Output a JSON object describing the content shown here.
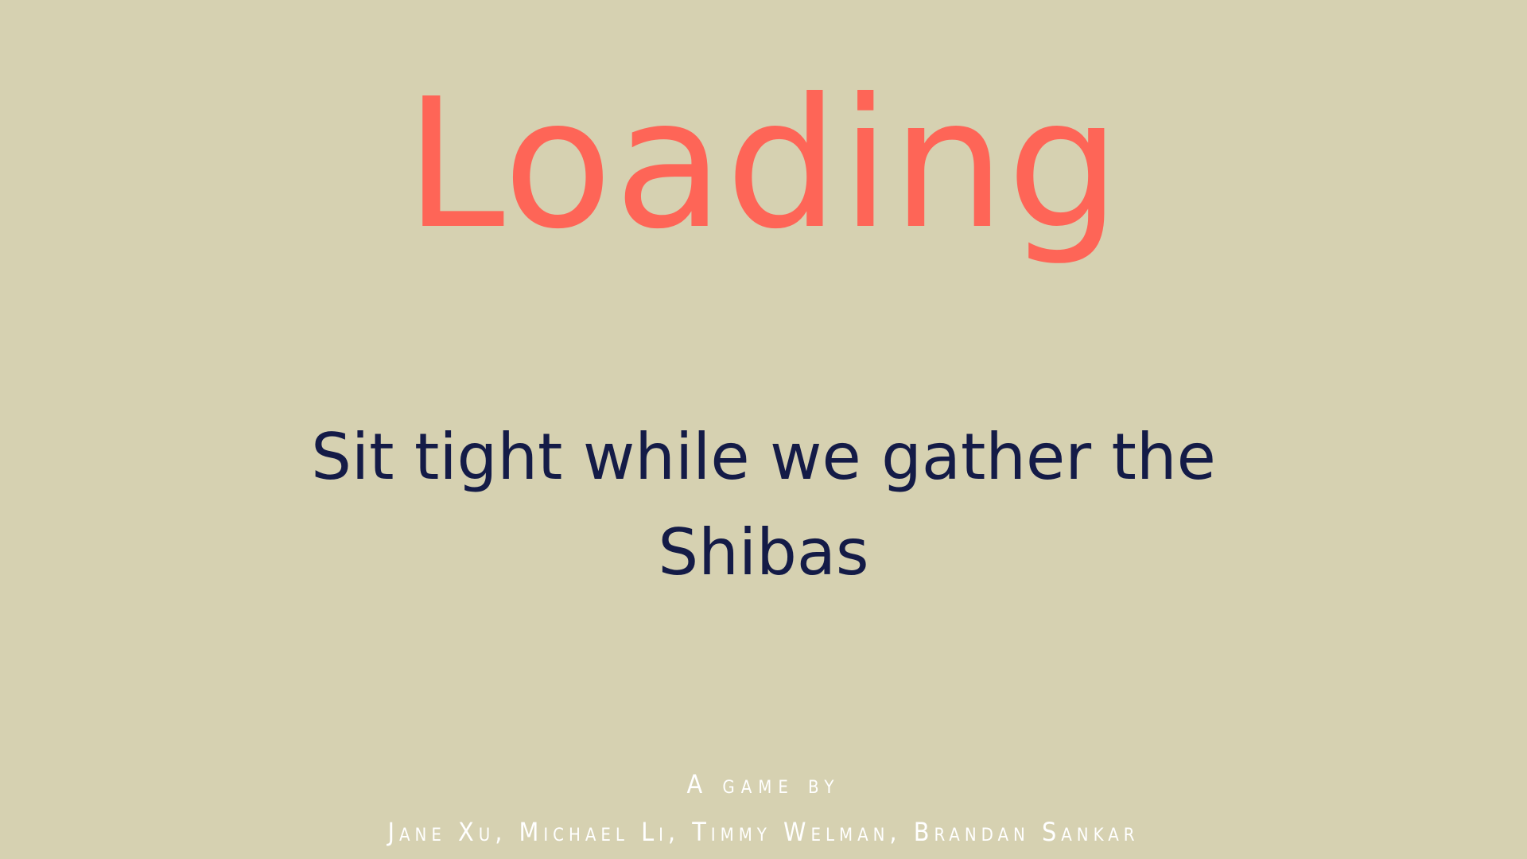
{
  "loading_screen": {
    "title": "Loading",
    "subtitle": "Sit tight while we gather the Shibas",
    "credits_label": "A game by",
    "credits_names": "Jane Xu, Michael Li, Timmy Welman, Brandan Sankar"
  },
  "colors": {
    "background": "#d6d1b1",
    "title": "#fe6557",
    "subtitle": "#141b47",
    "credits": "#ffffff"
  }
}
